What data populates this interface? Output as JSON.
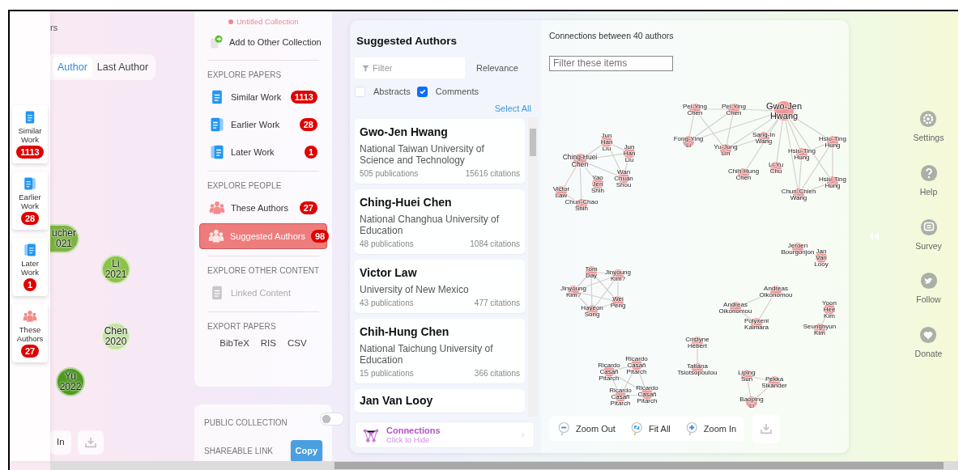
{
  "timeline": {
    "header_fragment": "rs",
    "tabs": [
      {
        "label": "Author",
        "selected": true
      },
      {
        "label": "Last Author",
        "selected": false
      }
    ],
    "nodes": [
      {
        "name": "ucher",
        "year": "021",
        "color": "#7cb342"
      },
      {
        "name": "Li",
        "year": "2021",
        "color": "#8bc34a"
      },
      {
        "name": "Chen",
        "year": "2020",
        "color": "#c5e1a5"
      },
      {
        "name": "Yu",
        "year": "2022",
        "color": "#4e9a1e"
      }
    ],
    "zoom_fragment": "In"
  },
  "side_cards": [
    {
      "label": "Similar Work",
      "count": "1113",
      "kind": "similar"
    },
    {
      "label": "Earlier Work",
      "count": "28",
      "kind": "earlier"
    },
    {
      "label": "Later Work",
      "count": "1",
      "kind": "later"
    },
    {
      "label": "These Authors",
      "count": "27",
      "kind": "people"
    }
  ],
  "menu": {
    "collection": "Untitled Collection",
    "add_label": "Add to Other Collection",
    "sections": [
      {
        "title": "EXPLORE PAPERS",
        "kind": "list",
        "items": [
          {
            "label": "Similar Work",
            "count": "1113",
            "kind": "similar",
            "selected": false,
            "disabled": false
          },
          {
            "label": "Earlier Work",
            "count": "28",
            "kind": "earlier",
            "selected": false,
            "disabled": false
          },
          {
            "label": "Later Work",
            "count": "1",
            "kind": "later",
            "selected": false,
            "disabled": false
          }
        ]
      },
      {
        "title": "EXPLORE PEOPLE",
        "kind": "list",
        "items": [
          {
            "label": "These Authors",
            "count": "27",
            "kind": "people",
            "selected": false,
            "disabled": false
          },
          {
            "label": "Suggested Authors",
            "count": "98",
            "kind": "people",
            "selected": true,
            "disabled": false
          }
        ]
      },
      {
        "title": "EXPLORE OTHER CONTENT",
        "kind": "list",
        "items": [
          {
            "label": "Linked Content",
            "kind": "linked",
            "selected": false,
            "disabled": true
          }
        ]
      },
      {
        "title": "EXPORT PAPERS",
        "kind": "export",
        "items": [
          {
            "label": "BibTeX"
          },
          {
            "label": "RIS"
          },
          {
            "label": "CSV"
          }
        ]
      }
    ]
  },
  "share": {
    "public": {
      "label": "PUBLIC COLLECTION",
      "on": false
    },
    "link_label": "SHAREABLE LINK",
    "copy": "Copy"
  },
  "authors": {
    "title": "Suggested Authors",
    "filter_placeholder": "Filter",
    "sort": "Relevance",
    "checks": [
      {
        "label": "Abstracts",
        "checked": false
      },
      {
        "label": "Comments",
        "checked": true
      }
    ],
    "select_all": "Select All",
    "list": [
      {
        "name": "Gwo-Jen Hwang",
        "affiliation": "National Taiwan University of Science and Technology",
        "publications": "505 publications",
        "citations": "15616 citations"
      },
      {
        "name": "Ching-Huei Chen",
        "affiliation": "National Changhua University of Education",
        "publications": "48 publications",
        "citations": "1084 citations"
      },
      {
        "name": "Victor Law",
        "affiliation": "University of New Mexico",
        "publications": "43 publications",
        "citations": "477 citations"
      },
      {
        "name": "Chih-Hung Chen",
        "affiliation": "National Taichung University of Education",
        "publications": "15 publications",
        "citations": "366 citations"
      },
      {
        "name": "Jan Van Looy"
      }
    ],
    "footer": {
      "title": "Connections",
      "subtitle": "Click to Hide"
    }
  },
  "graph": {
    "title": "Connections between 40 authors",
    "filter_placeholder": "Filter these items",
    "nodes": [
      {
        "label": "Pei-Ying Chen",
        "kind": "minor"
      },
      {
        "label": "Pei-Ying Chen",
        "kind": "minor"
      },
      {
        "label": "Gwo-Jen Hwang",
        "kind": "main"
      },
      {
        "label": "Fong-Ying Li",
        "kind": "minor"
      },
      {
        "label": "Sang-In Wang",
        "kind": "minor"
      },
      {
        "label": "Yu-Jung Lin",
        "kind": "minor"
      },
      {
        "label": "Chih-Hung Chen",
        "kind": "minor"
      },
      {
        "label": "Li-Yu Chu",
        "kind": "minor"
      },
      {
        "label": "Hsiu-Ting Hung",
        "kind": "minor"
      },
      {
        "label": "Hsiu-Ting Hung",
        "kind": "minor"
      },
      {
        "label": "Hsiu-Ting Hung",
        "kind": "minor"
      },
      {
        "label": "Chun-Chieh Wang",
        "kind": "minor"
      },
      {
        "label": "Jun Han Liu",
        "kind": "minor"
      },
      {
        "label": "Jun Han Liu",
        "kind": "minor"
      },
      {
        "label": "Ching-Huei Chen",
        "kind": "medium"
      },
      {
        "label": "Wan Chuan Shou",
        "kind": "minor"
      },
      {
        "label": "Yao Jen Shih",
        "kind": "minor"
      },
      {
        "label": "Victor Law",
        "kind": "minor"
      },
      {
        "label": "Chun-Chao Shih",
        "kind": "minor"
      },
      {
        "label": "Jeroen Bourgonjon",
        "kind": "minor"
      },
      {
        "label": "Jan Van Looy",
        "kind": "minor"
      },
      {
        "label": "Tom Day",
        "kind": "minor"
      },
      {
        "label": "Jinyoung Kim?",
        "kind": "minor"
      },
      {
        "label": "Jinyoung Kim?",
        "kind": "minor"
      },
      {
        "label": "Wei Peng",
        "kind": "minor"
      },
      {
        "label": "Hayeon Song",
        "kind": "minor"
      },
      {
        "label": "Andreas Oikonomou",
        "kind": "minor"
      },
      {
        "label": "Andreas Oikonomou",
        "kind": "minor"
      },
      {
        "label": "Polyxeni Kaimara",
        "kind": "minor"
      },
      {
        "label": "Yoon Hee Kim",
        "kind": "minor"
      },
      {
        "label": "Seunghyun Kim",
        "kind": "minor"
      },
      {
        "label": "Cristyne Hébert",
        "kind": "minor"
      },
      {
        "label": "Ricardo Casañ Pitarch",
        "kind": "minor"
      },
      {
        "label": "Ricardo Casañ Pitarch",
        "kind": "minor"
      },
      {
        "label": "Tatiana Tsiotsopoulou",
        "kind": "minor"
      },
      {
        "label": "Ricardo Casañ Pitarch",
        "kind": "minor"
      },
      {
        "label": "Ricardo Casañ Pitarch",
        "kind": "minor"
      },
      {
        "label": "Liping Sun",
        "kind": "minor"
      },
      {
        "label": "Pekka Sikander",
        "kind": "minor"
      },
      {
        "label": "Baoping Li",
        "kind": "minor"
      }
    ],
    "controls": [
      {
        "label": "Zoom Out",
        "kind": "zoom-out"
      },
      {
        "label": "Fit All",
        "kind": "fit"
      },
      {
        "label": "Zoom In",
        "kind": "zoom-in"
      }
    ]
  },
  "sidebar": [
    {
      "label": "Settings",
      "kind": "settings"
    },
    {
      "label": "Help",
      "kind": "help"
    },
    {
      "label": "Survey",
      "kind": "survey"
    },
    {
      "label": "Follow",
      "kind": "follow"
    },
    {
      "label": "Donate",
      "kind": "donate"
    }
  ]
}
